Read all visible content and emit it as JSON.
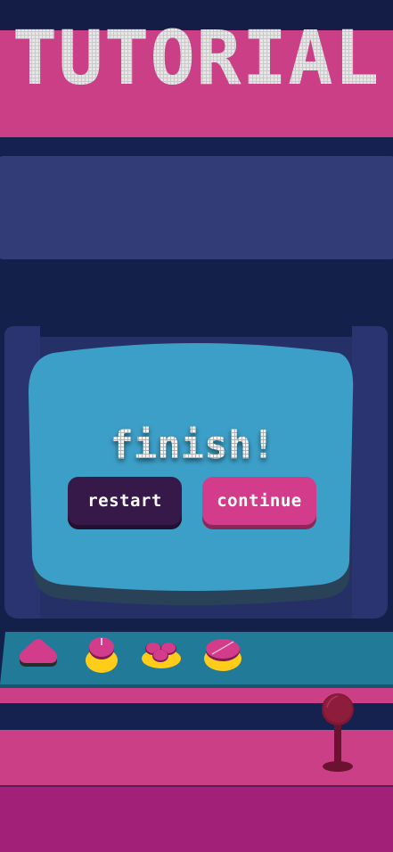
{
  "title": "TUTORIAL",
  "screen": {
    "message": "finish!"
  },
  "buttons": {
    "restart_label": "restart",
    "continue_label": "continue"
  },
  "controls": {
    "items": [
      "triangle-button-icon",
      "knob-button-icon",
      "cluster-button-icon",
      "dome-button-icon"
    ],
    "joystick": "joystick-icon"
  },
  "colors": {
    "background": "#13204a",
    "band_pink": "#cb3f86",
    "screen_blue": "#3c9fc8",
    "title_panel": "#323c77",
    "restart_button": "#361949",
    "continue_button": "#d33c8a",
    "control_panel": "#217a98",
    "accent_yellow": "#ffcc1a"
  }
}
